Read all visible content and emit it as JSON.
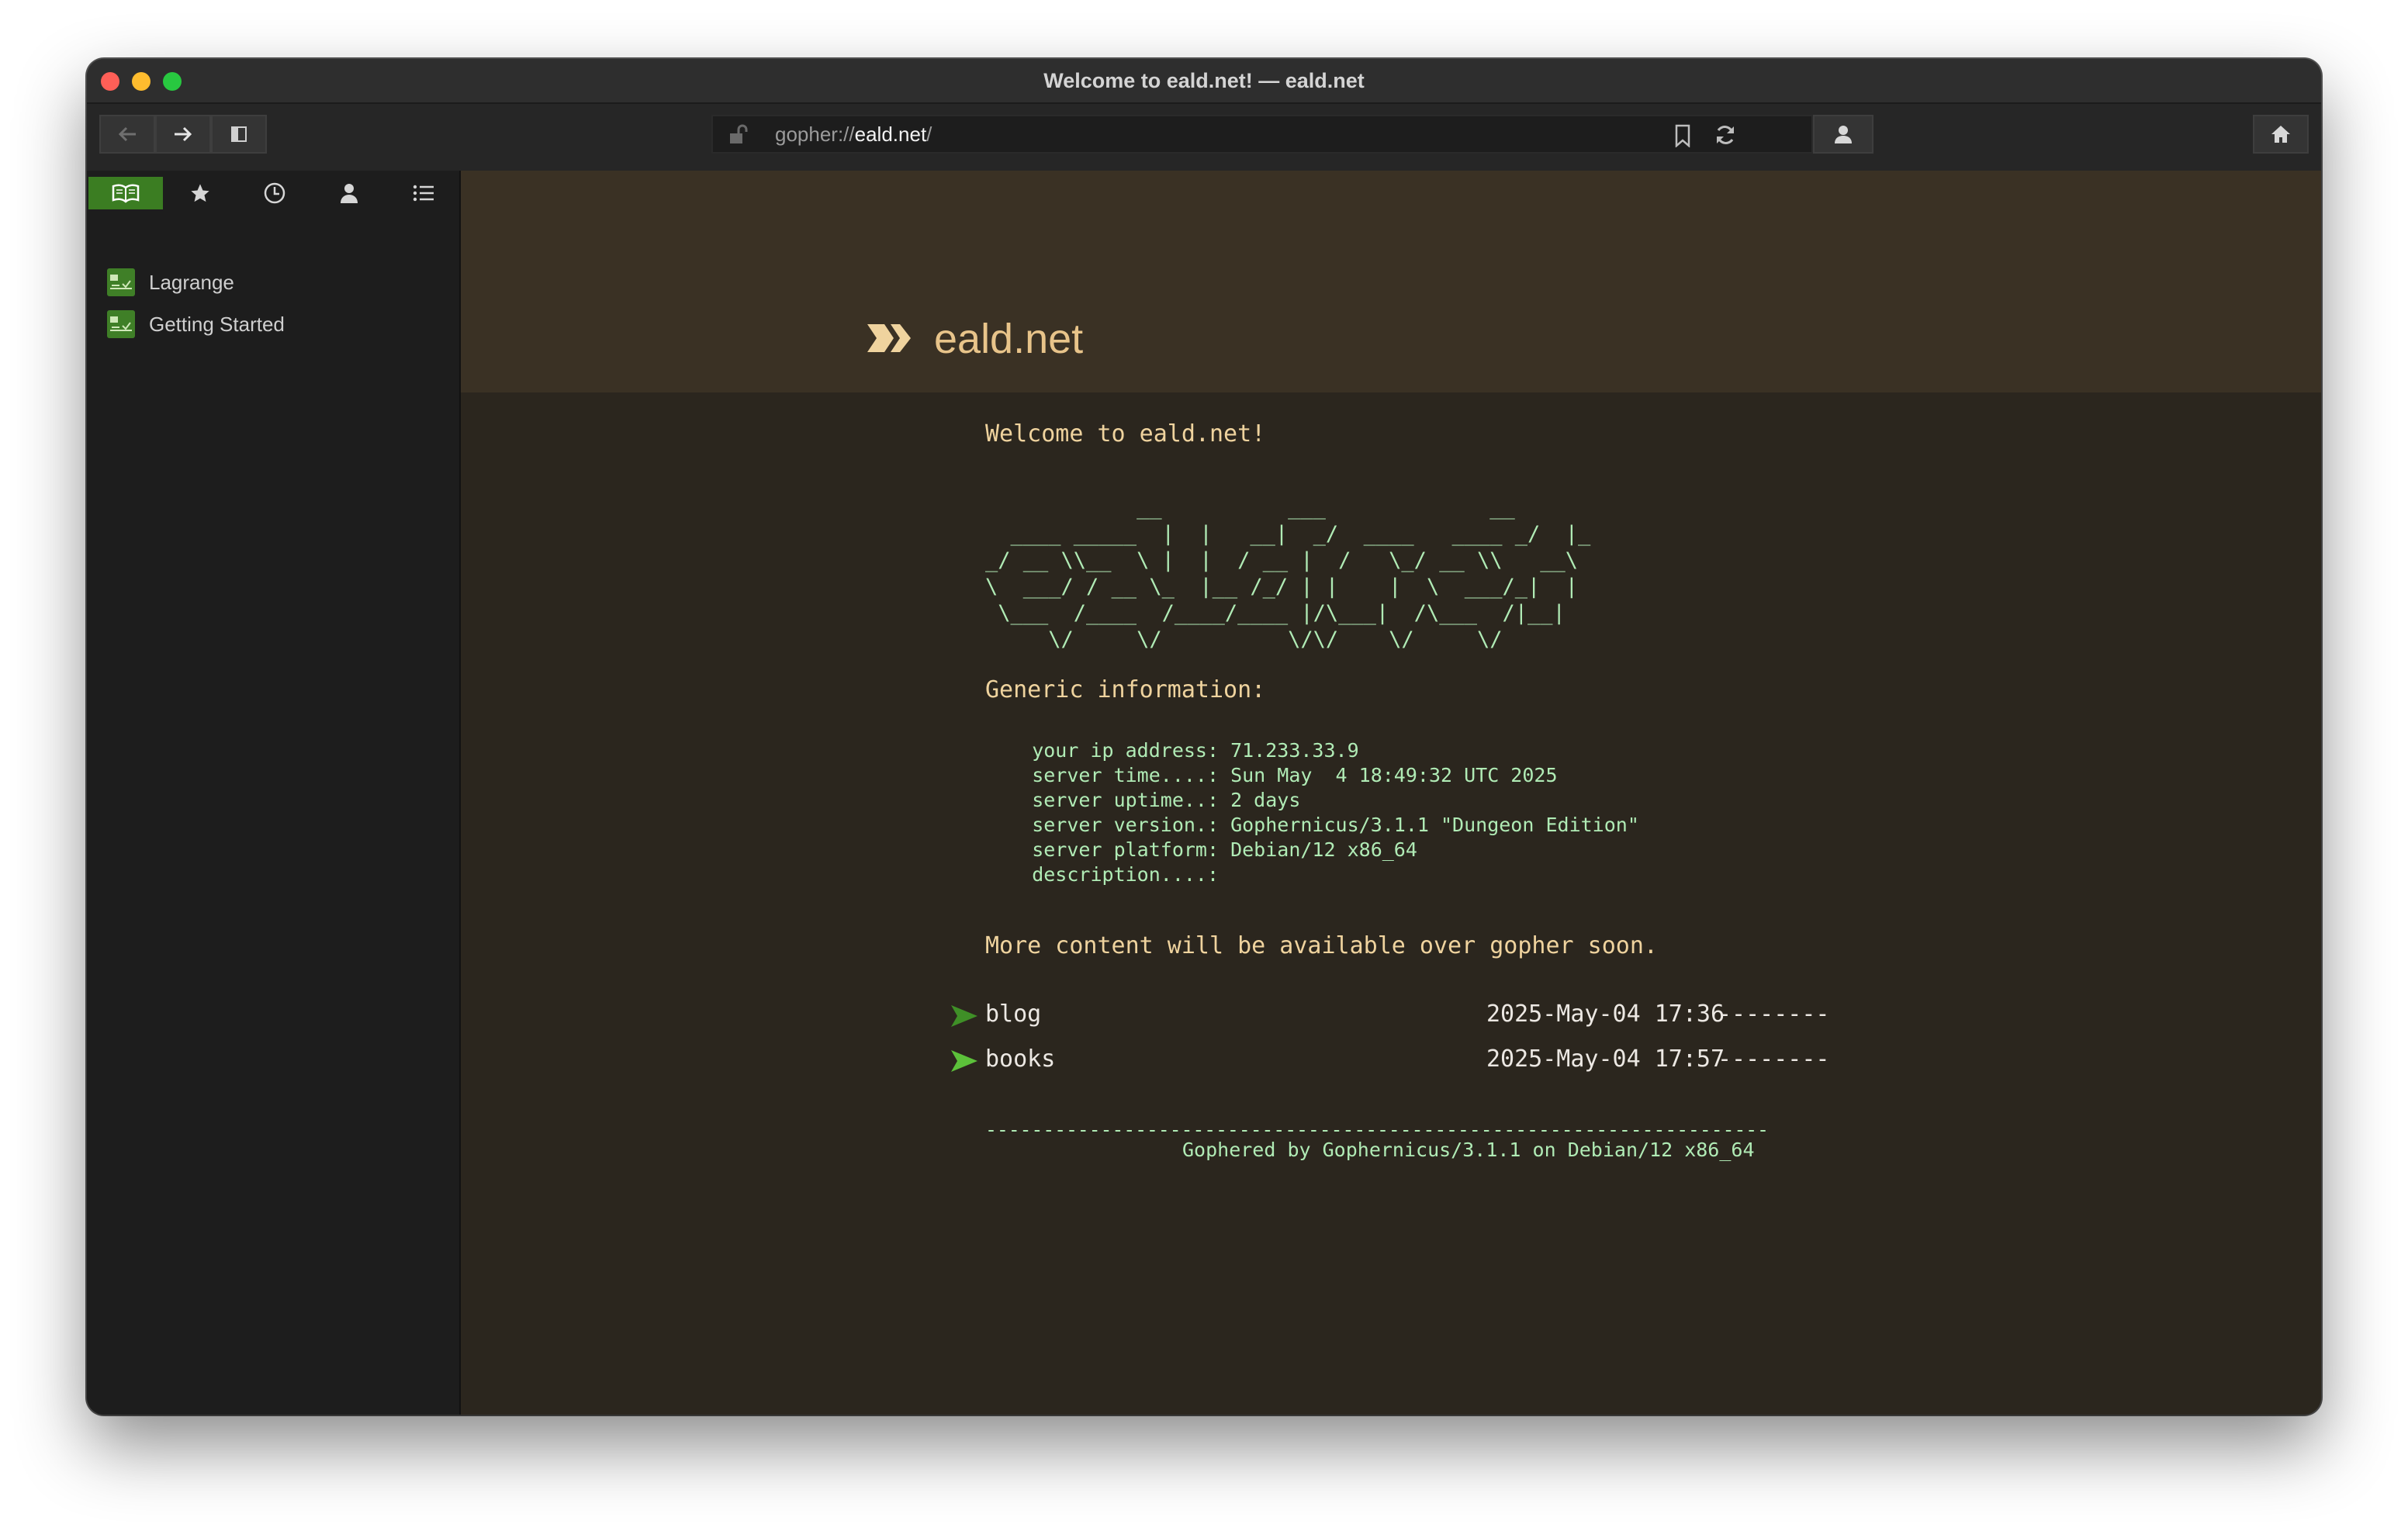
{
  "window": {
    "title": "Welcome to eald.net! — eald.net",
    "traffic_lights": {
      "close": "#ff5f57",
      "minimize": "#febc2e",
      "zoom": "#28c840"
    }
  },
  "toolbar": {
    "back_icon": "arrow-left-icon",
    "forward_icon": "arrow-right-icon",
    "sidebar_toggle_icon": "sidebar-icon",
    "url": {
      "scheme": "gopher://",
      "host": "eald.net",
      "path": "/"
    },
    "bookmark_icon": "bookmark-icon",
    "reload_icon": "reload-icon",
    "identity_icon": "person-icon",
    "home_icon": "home-icon"
  },
  "sidebar": {
    "tabs": [
      "book-icon",
      "star-icon",
      "clock-icon",
      "person-icon",
      "list-icon"
    ],
    "active_tab": "book-icon",
    "items": [
      {
        "label": "Lagrange"
      },
      {
        "label": "Getting Started"
      }
    ]
  },
  "page": {
    "site_name": "eald.net",
    "welcome": "Welcome to eald.net!",
    "ascii_art": "            __          ___             __\n  ____ _____  |  |   __|  _/  ____   ____ _/  |_\n_/ __ \\\\__  \\ |  |  / __ |  /   \\_/ __ \\\\   __\\\n\\  ___/ / __ \\_  |__ /_/ | |    |  \\  ___/_|  |\n \\___  /____  /____/____ |/\\___|  /\\___  /|__|\n     \\/     \\/          \\/\\/    \\/     \\/",
    "generic_heading": "Generic information:",
    "info_lines": [
      "    your ip address: 71.233.33.9",
      "    server time....: Sun May  4 18:49:32 UTC 2025",
      "    server uptime..: 2 days",
      "    server version.: Gophernicus/3.1.1 \"Dungeon Edition\"",
      "    server platform: Debian/12 x86_64",
      "    description....:"
    ],
    "more_content": "More content will be available over gopher soon.",
    "links": [
      {
        "label": "blog",
        "date": "2025-May-04 17:36",
        "size": "--------"
      },
      {
        "label": "books",
        "date": "2025-May-04 17:57",
        "size": "--------"
      }
    ],
    "footer_rule": "--------------------------------------------------------------------",
    "footer": "Gophered by Gophernicus/3.1.1 on Debian/12 x86_64"
  },
  "colors": {
    "banner_bg": "#3a3124",
    "page_bg": "#2b261e",
    "heading": "#efd39e",
    "preformatted": "#b0ebb5",
    "link_arrow": "#4caf2e"
  }
}
